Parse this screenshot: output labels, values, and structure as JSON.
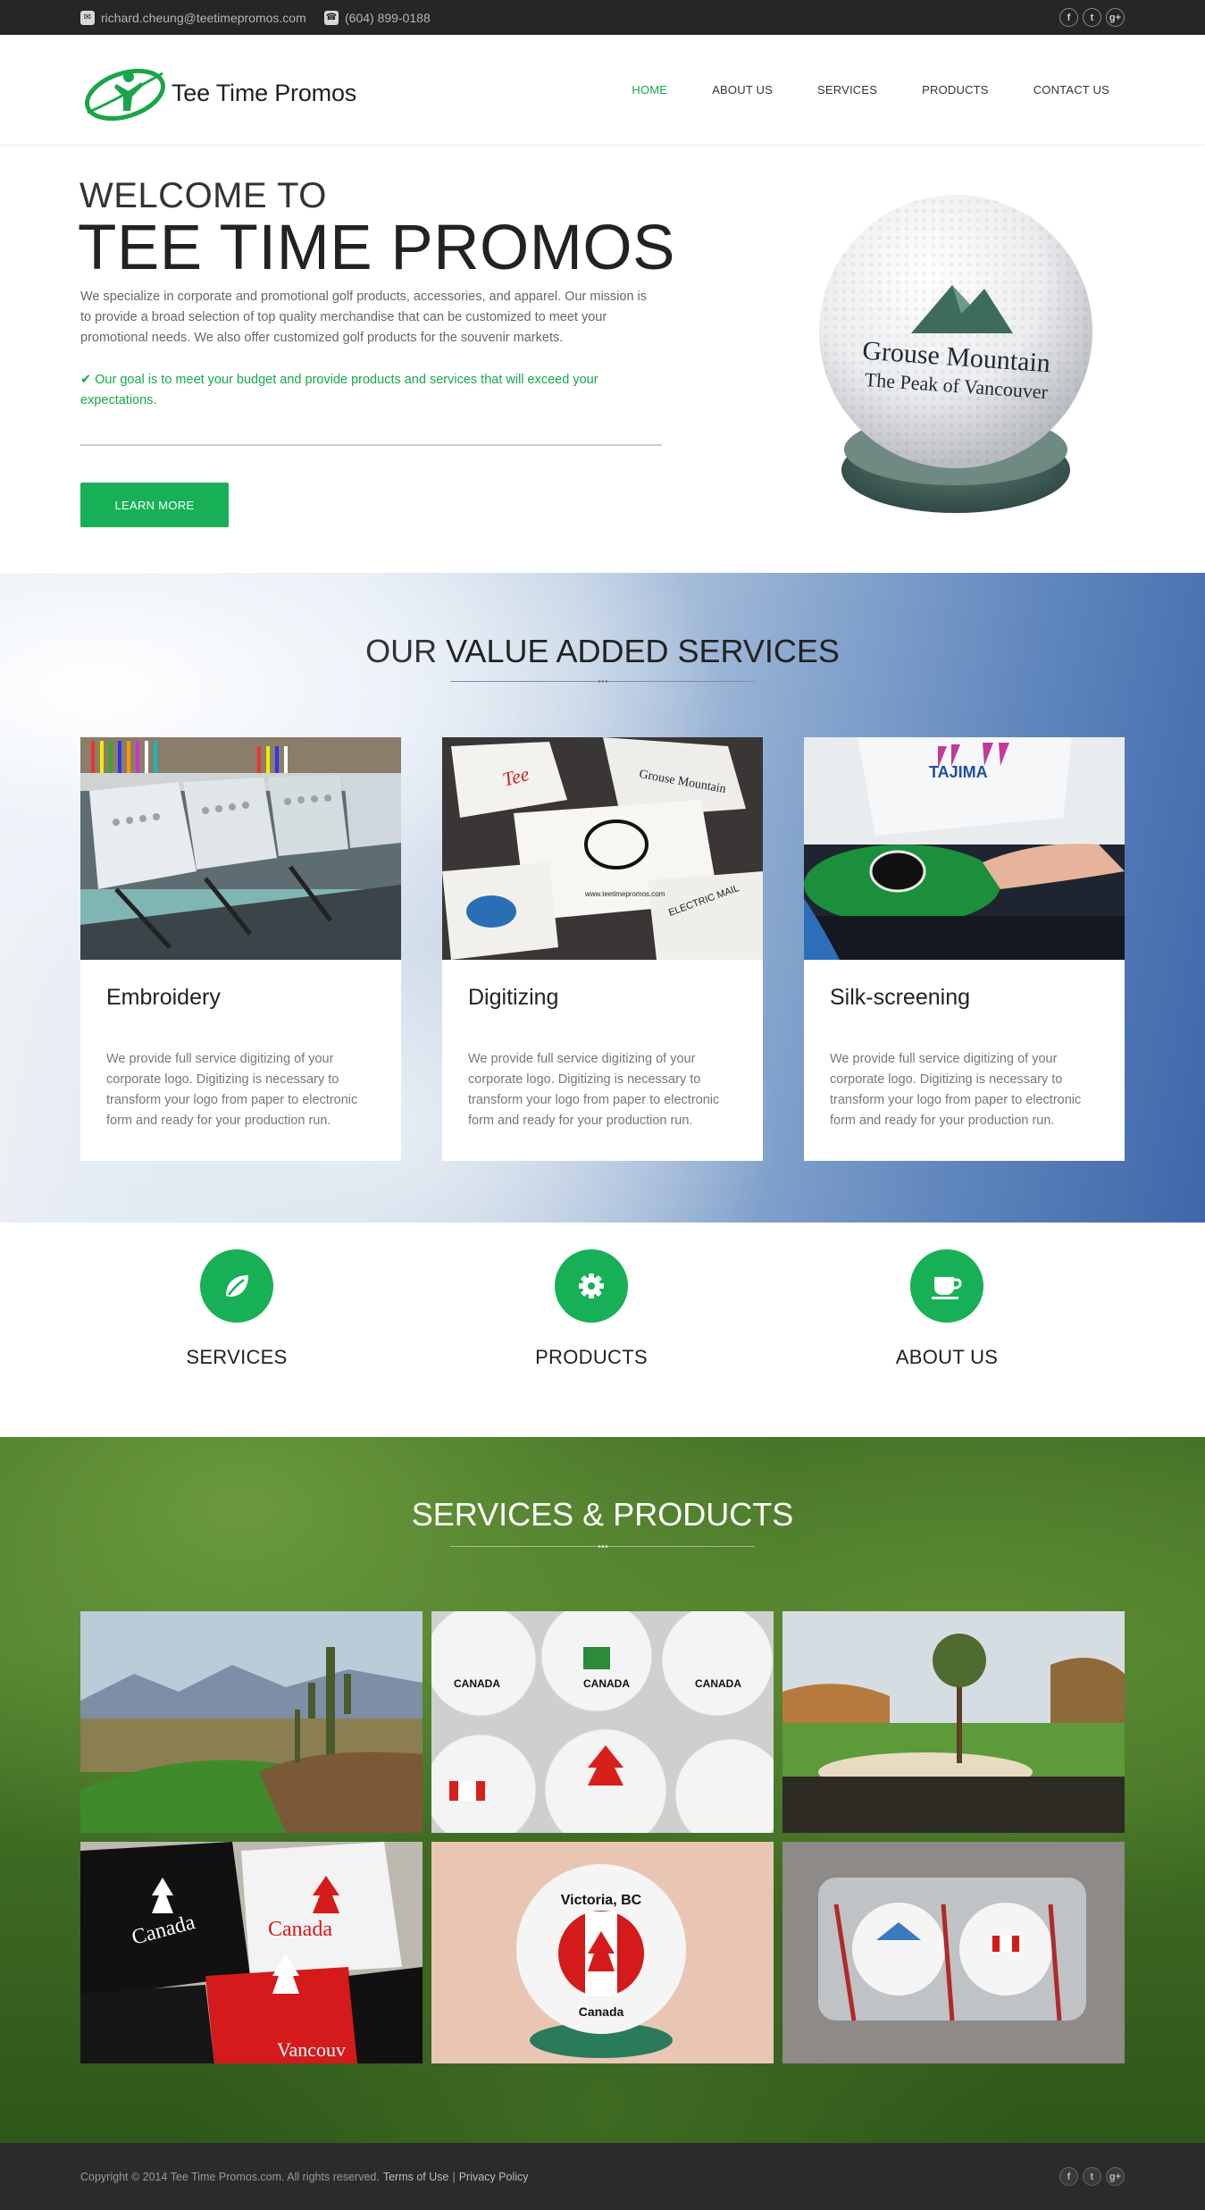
{
  "topbar": {
    "email": "richard.cheung@teetimepromos.com",
    "phone": "(604) 899-0188",
    "email_icon": "envelope-icon",
    "phone_icon": "phone-icon",
    "social": [
      {
        "icon": "facebook-icon",
        "glyph": "f"
      },
      {
        "icon": "twitter-icon",
        "glyph": "t"
      },
      {
        "icon": "google-plus-icon",
        "glyph": "g+"
      }
    ]
  },
  "header": {
    "logo_text": "Tee Time Promos",
    "nav": [
      {
        "label": "HOME",
        "active": true
      },
      {
        "label": "ABOUT US",
        "active": false
      },
      {
        "label": "SERVICES",
        "active": false
      },
      {
        "label": "PRODUCTS",
        "active": false
      },
      {
        "label": "CONTACT US",
        "active": false
      }
    ]
  },
  "hero": {
    "pre_title": "WELCOME TO",
    "title": "TEE TIME PROMOS",
    "description": "We specialize in corporate and promotional golf products, accessories, and apparel. Our mission is to provide a broad selection of top quality merchandise that can be customized to meet your promotional needs. We also offer customized golf products for the souvenir markets.",
    "goal": "Our goal is to meet your budget and provide products and services that will exceed your expectations.",
    "button": "LEARN MORE",
    "ball_text_line1": "Grouse Mountain",
    "ball_text_line2": "The Peak of Vancouver"
  },
  "value_services": {
    "title_light": "OUR",
    "title_bold": "VALUE ADDED SERVICES",
    "cards": [
      {
        "title": "Embroidery",
        "text": "We provide full service digitizing of your corporate logo. Digitizing is necessary to transform your logo from paper to electronic form and ready for your production run."
      },
      {
        "title": "Digitizing",
        "text": "We provide full service digitizing of your corporate logo. Digitizing is necessary to transform your logo from paper to electronic form and ready for your production run."
      },
      {
        "title": "Silk-screening",
        "text": "We provide full service digitizing of your corporate logo. Digitizing is necessary to transform your logo from paper to electronic form and ready for your production run."
      }
    ]
  },
  "features": [
    {
      "label": "SERVICES",
      "icon": "leaf-icon"
    },
    {
      "label": "PRODUCTS",
      "icon": "gear-icon"
    },
    {
      "label": "ABOUT US",
      "icon": "coffee-cup-icon"
    }
  ],
  "services_products": {
    "title_bold": "SERVICES &",
    "title_light": "PRODUCTS"
  },
  "footer": {
    "copyright": "Copyright © 2014 Tee Time Promos.com. All rights reserved.",
    "terms": "Terms of Use",
    "separator": "|",
    "privacy": "Privacy Policy"
  },
  "colors": {
    "accent_green": "#17b057",
    "topbar_bg": "#262626",
    "footer_bg": "#2b2b2b"
  }
}
